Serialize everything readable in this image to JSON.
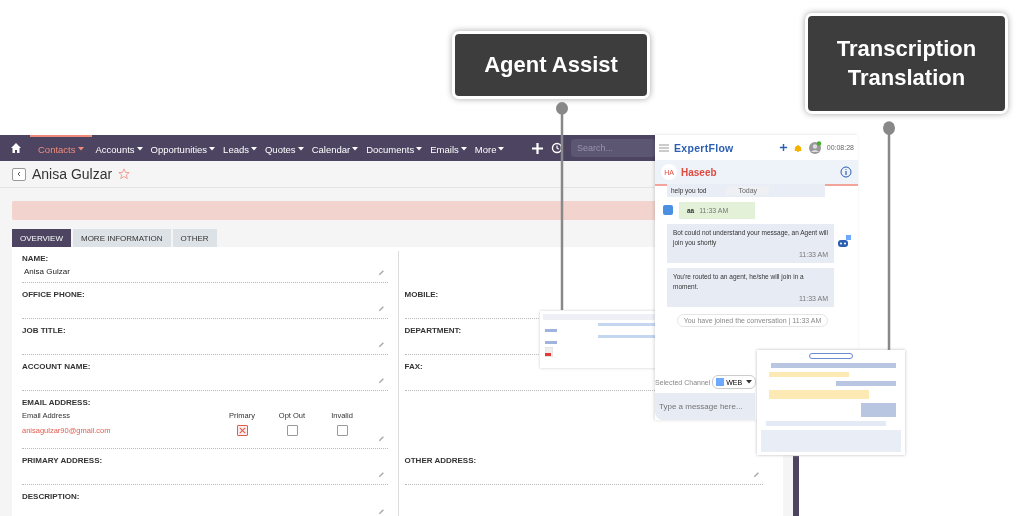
{
  "callouts": [
    {
      "text": "Agent Assist"
    },
    {
      "text": "Transcription Translation"
    }
  ],
  "crm": {
    "nav": [
      {
        "label": "Contacts",
        "selected": true
      },
      {
        "label": "Accounts",
        "selected": false
      },
      {
        "label": "Opportunities",
        "selected": false
      },
      {
        "label": "Leads",
        "selected": false
      },
      {
        "label": "Quotes",
        "selected": false
      },
      {
        "label": "Calendar",
        "selected": false
      },
      {
        "label": "Documents",
        "selected": false
      },
      {
        "label": "Emails",
        "selected": false
      },
      {
        "label": "More",
        "selected": false
      }
    ],
    "search": {
      "placeholder": "Search..."
    },
    "record": {
      "title": "Anisa Gulzar",
      "starred": false
    },
    "tabs": [
      {
        "label": "OVERVIEW",
        "selected": true
      },
      {
        "label": "MORE INFORMATION",
        "selected": false
      },
      {
        "label": "OTHER",
        "selected": false
      }
    ],
    "rows": [
      {
        "kind": "field",
        "left": {
          "label": "NAME:",
          "value": "Anisa Gulzar"
        },
        "right": null
      },
      {
        "kind": "field",
        "left": {
          "label": "OFFICE PHONE:"
        },
        "right": {
          "label": "MOBILE:"
        }
      },
      {
        "kind": "field",
        "left": {
          "label": "JOB TITLE:"
        },
        "right": {
          "label": "DEPARTMENT:"
        }
      },
      {
        "kind": "field",
        "left": {
          "label": "ACCOUNT NAME:"
        },
        "right": {
          "label": "FAX:"
        }
      },
      {
        "kind": "email",
        "left": {
          "label": "EMAIL ADDRESS:"
        },
        "right": null
      },
      {
        "kind": "field",
        "left": {
          "label": "PRIMARY ADDRESS:"
        },
        "right": {
          "label": "OTHER ADDRESS:",
          "edit_icon": true
        }
      },
      {
        "kind": "field",
        "left": {
          "label": "DESCRIPTION:"
        },
        "right": null
      }
    ],
    "email": {
      "column_header": "Email Address",
      "flags": [
        "Primary",
        "Opt Out",
        "Invalid"
      ],
      "address": "anisagulzar90@gmail.com",
      "primary": true,
      "opt_out": false,
      "invalid": false
    }
  },
  "chat": {
    "brand": "ExpertFlow",
    "timer": "00:08:28",
    "contact": {
      "initials": "HA",
      "name": "Haseeb"
    },
    "partial": "help you tod",
    "day": "Today",
    "messages": [
      {
        "kind": "customer",
        "text": "aa",
        "time": "11:33 AM"
      },
      {
        "kind": "bot",
        "text": "Bot could not understand your message, an Agent will join you shortly",
        "time": "11:33 AM"
      },
      {
        "kind": "bot",
        "text": "You're routed to an agent, he/she will join in a moment.",
        "time": "11:33 AM"
      }
    ],
    "notice": "You have joined the conversation | 11:33 AM",
    "channel_label": "Selected Channel",
    "channel": "WEB",
    "composer": {
      "placeholder": "Type a message here..."
    }
  }
}
